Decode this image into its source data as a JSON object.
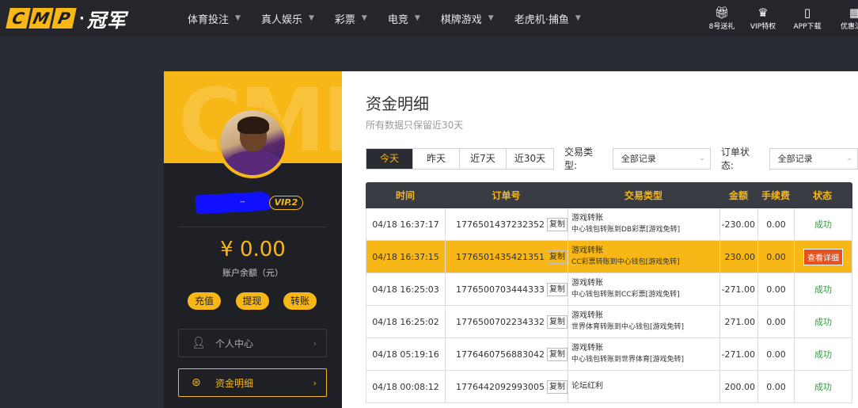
{
  "header": {
    "logo_letters": [
      "C",
      "M",
      "P"
    ],
    "logo_dot": "·",
    "logo_cn": "冠军",
    "nav": [
      {
        "label": "体育投注"
      },
      {
        "label": "真人娱乐"
      },
      {
        "label": "彩票"
      },
      {
        "label": "电竞"
      },
      {
        "label": "棋牌游戏"
      },
      {
        "label": "老虎机·捕鱼"
      }
    ],
    "shortcuts": [
      {
        "label": "8号送礼",
        "icon": "gift-icon"
      },
      {
        "label": "VIP特权",
        "icon": "crown-icon"
      },
      {
        "label": "APP下载",
        "icon": "phone-icon"
      },
      {
        "label": "优惠活动",
        "icon": "grid-icon"
      }
    ]
  },
  "sidebar": {
    "watermark": "CMP",
    "username": "--",
    "vip": "VIP.2",
    "balance": "¥ 0.00",
    "balance_label": "账户余额（元）",
    "actions": [
      "充值",
      "提现",
      "转账"
    ],
    "menu": [
      {
        "label": "个人中心",
        "icon": "user-icon"
      },
      {
        "label": "资金明细",
        "icon": "money-icon"
      }
    ]
  },
  "main": {
    "title": "资金明细",
    "subtitle": "所有数据只保留近30天",
    "periods": [
      "今天",
      "昨天",
      "近7天",
      "近30天"
    ],
    "type_label": "交易类型:",
    "type_value": "全部记录",
    "status_label": "订单状态:",
    "status_value": "全部记录",
    "columns": [
      "时间",
      "订单号",
      "交易类型",
      "金额",
      "手续费",
      "状态"
    ],
    "copy_label": "复制",
    "rows": [
      {
        "time": "04/18 16:37:17",
        "order": "1776501437232352",
        "type": "游戏转账",
        "detail": "中心钱包转账到DB彩票[游戏免转]",
        "amount": "-230.00",
        "fee": "0.00",
        "status": "成功",
        "highlight": false
      },
      {
        "time": "04/18 16:37:15",
        "order": "1776501435421351",
        "type": "游戏转账",
        "detail": "CC彩票转账到中心钱包[游戏免转]",
        "amount": "230.00",
        "fee": "0.00",
        "status": "查看详细",
        "highlight": true
      },
      {
        "time": "04/18 16:25:03",
        "order": "1776500703444333",
        "type": "游戏转账",
        "detail": "中心钱包转账到CC彩票[游戏免转]",
        "amount": "-271.00",
        "fee": "0.00",
        "status": "成功",
        "highlight": false
      },
      {
        "time": "04/18 16:25:02",
        "order": "1776500702234332",
        "type": "游戏转账",
        "detail": "世界体育转账到中心钱包[游戏免转]",
        "amount": "271.00",
        "fee": "0.00",
        "status": "成功",
        "highlight": false
      },
      {
        "time": "04/18 05:19:16",
        "order": "1776460756883042",
        "type": "游戏转账",
        "detail": "中心钱包转账到世界体育[游戏免转]",
        "amount": "-271.00",
        "fee": "0.00",
        "status": "成功",
        "highlight": false
      },
      {
        "time": "04/18 00:08:12",
        "order": "1776442092993005",
        "type": "论坛红利",
        "detail": "",
        "amount": "200.00",
        "fee": "0.00",
        "status": "成功",
        "highlight": false
      }
    ]
  },
  "colors": {
    "accent": "#f7b716",
    "success": "#2e9f3a",
    "detail_button": "#e8501e",
    "user_blob": "#1010ff"
  }
}
